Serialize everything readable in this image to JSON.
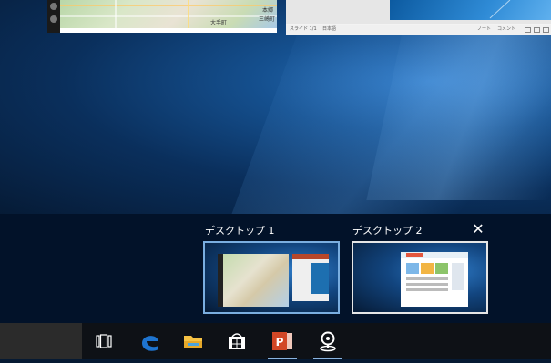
{
  "map_window": {
    "labels": [
      "大手町",
      "本郷",
      "三崎町"
    ]
  },
  "ppt_window": {
    "status": {
      "slide": "スライド 1/1",
      "language": "日本語",
      "notes": "ノート",
      "comments": "コメント"
    }
  },
  "task_view": {
    "desktops": [
      {
        "label": "デスクトップ 1",
        "active": true
      },
      {
        "label": "デスクトップ 2",
        "active": false
      }
    ],
    "close_icon": "close-icon",
    "close_glyph": "✕"
  },
  "taskbar": {
    "items": [
      {
        "name": "task-view-icon",
        "active": false
      },
      {
        "name": "edge-icon",
        "active": false
      },
      {
        "name": "file-explorer-icon",
        "active": false
      },
      {
        "name": "store-icon",
        "active": false
      },
      {
        "name": "powerpoint-icon",
        "active": true
      },
      {
        "name": "maps-icon",
        "active": true
      }
    ],
    "powerpoint_letter": "P"
  },
  "colors": {
    "accent": "#8ab4e0",
    "powerpoint": "#d24726",
    "edge": "#1e74d0",
    "explorer": "#f6c244"
  }
}
